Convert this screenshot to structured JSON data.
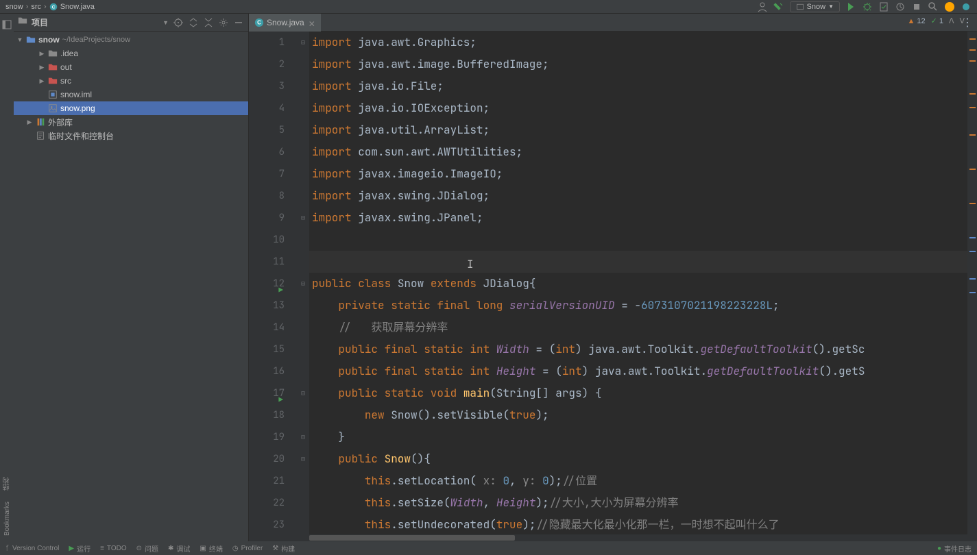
{
  "breadcrumb": [
    "snow",
    "src",
    "Snow.java"
  ],
  "runConfig": "Snow",
  "panel": {
    "title": "项目"
  },
  "tree": {
    "root": {
      "name": "snow",
      "path": "~/IdeaProjects/snow"
    },
    "items": [
      {
        "name": ".idea",
        "indent": 1,
        "expandable": true,
        "icon": "folder"
      },
      {
        "name": "out",
        "indent": 1,
        "expandable": true,
        "icon": "folder-red"
      },
      {
        "name": "src",
        "indent": 1,
        "expandable": true,
        "icon": "folder-red"
      },
      {
        "name": "snow.iml",
        "indent": 1,
        "expandable": false,
        "icon": "module"
      },
      {
        "name": "snow.png",
        "indent": 1,
        "expandable": false,
        "icon": "image",
        "selected": true
      },
      {
        "name": "外部库",
        "indent": 0,
        "expandable": true,
        "icon": "library"
      },
      {
        "name": "临时文件和控制台",
        "indent": 0,
        "expandable": false,
        "icon": "scratch"
      }
    ]
  },
  "tabs": [
    {
      "name": "Snow.java"
    }
  ],
  "inspection": {
    "warnings": 12,
    "pass": 1
  },
  "code": [
    {
      "n": 1,
      "tokens": [
        [
          "kw",
          "import"
        ],
        [
          "",
          " java.awt.Graphics;"
        ]
      ]
    },
    {
      "n": 2,
      "tokens": [
        [
          "kw",
          "import"
        ],
        [
          "",
          " java.awt.image.BufferedImage;"
        ]
      ]
    },
    {
      "n": 3,
      "tokens": [
        [
          "kw",
          "import"
        ],
        [
          "",
          " java.io.File;"
        ]
      ]
    },
    {
      "n": 4,
      "tokens": [
        [
          "kw",
          "import"
        ],
        [
          "",
          " java.io.IOException;"
        ]
      ]
    },
    {
      "n": 5,
      "tokens": [
        [
          "kw",
          "import"
        ],
        [
          "",
          " java.util.ArrayList;"
        ]
      ]
    },
    {
      "n": 6,
      "tokens": [
        [
          "kw",
          "import"
        ],
        [
          "",
          " com.sun.awt.AWTUtilities;"
        ]
      ]
    },
    {
      "n": 7,
      "tokens": [
        [
          "kw",
          "import"
        ],
        [
          "",
          " javax.imageio.ImageIO;"
        ]
      ]
    },
    {
      "n": 8,
      "tokens": [
        [
          "kw",
          "import"
        ],
        [
          "",
          " javax.swing.JDialog;"
        ]
      ]
    },
    {
      "n": 9,
      "tokens": [
        [
          "kw",
          "import"
        ],
        [
          "",
          " javax.swing.JPanel;"
        ]
      ]
    },
    {
      "n": 10,
      "tokens": []
    },
    {
      "n": 11,
      "tokens": [],
      "current": true
    },
    {
      "n": 12,
      "tokens": [
        [
          "kw",
          "public class "
        ],
        [
          "cls",
          "Snow "
        ],
        [
          "kw",
          "extends "
        ],
        [
          "cls",
          "JDialog"
        ],
        [
          "",
          "{"
        ]
      ],
      "run": true
    },
    {
      "n": 13,
      "tokens": [
        [
          "",
          "    "
        ],
        [
          "kw",
          "private static final long "
        ],
        [
          "fld",
          "serialVersionUID"
        ],
        [
          "",
          " = -"
        ],
        [
          "num",
          "6073107021198223228L"
        ],
        [
          "",
          ";"
        ]
      ]
    },
    {
      "n": 14,
      "tokens": [
        [
          "",
          "    "
        ],
        [
          "cmt",
          "//   获取屏幕分辨率"
        ]
      ]
    },
    {
      "n": 15,
      "tokens": [
        [
          "",
          "    "
        ],
        [
          "kw",
          "public final static int "
        ],
        [
          "fld",
          "Width"
        ],
        [
          "",
          " = ("
        ],
        [
          "kw",
          "int"
        ],
        [
          "",
          ") java.awt.Toolkit."
        ],
        [
          "fld",
          "getDefaultToolkit"
        ],
        [
          "",
          "().getSc"
        ]
      ]
    },
    {
      "n": 16,
      "tokens": [
        [
          "",
          "    "
        ],
        [
          "kw",
          "public final static int "
        ],
        [
          "fld",
          "Height"
        ],
        [
          "",
          " = ("
        ],
        [
          "kw",
          "int"
        ],
        [
          "",
          ") java.awt.Toolkit."
        ],
        [
          "fld",
          "getDefaultToolkit"
        ],
        [
          "",
          "().getS"
        ]
      ]
    },
    {
      "n": 17,
      "tokens": [
        [
          "",
          "    "
        ],
        [
          "kw",
          "public static void "
        ],
        [
          "mth",
          "main"
        ],
        [
          "",
          "(String[] args) {"
        ]
      ],
      "run": true
    },
    {
      "n": 18,
      "tokens": [
        [
          "",
          "        "
        ],
        [
          "kw",
          "new "
        ],
        [
          "",
          "Snow().setVisible("
        ],
        [
          "kw",
          "true"
        ],
        [
          "",
          ");"
        ]
      ]
    },
    {
      "n": 19,
      "tokens": [
        [
          "",
          "    }"
        ]
      ]
    },
    {
      "n": 20,
      "tokens": [
        [
          "",
          "    "
        ],
        [
          "kw",
          "public "
        ],
        [
          "mth",
          "Snow"
        ],
        [
          "",
          "(){"
        ]
      ]
    },
    {
      "n": 21,
      "tokens": [
        [
          "",
          "        "
        ],
        [
          "kw",
          "this"
        ],
        [
          "",
          ".setLocation( "
        ],
        [
          "param",
          "x: "
        ],
        [
          "num",
          "0"
        ],
        [
          "",
          ", "
        ],
        [
          "param",
          "y: "
        ],
        [
          "num",
          "0"
        ],
        [
          "",
          ");"
        ],
        [
          "cmt",
          "//位置"
        ]
      ]
    },
    {
      "n": 22,
      "tokens": [
        [
          "",
          "        "
        ],
        [
          "kw",
          "this"
        ],
        [
          "",
          ".setSize("
        ],
        [
          "fld",
          "Width"
        ],
        [
          "",
          ", "
        ],
        [
          "fld",
          "Height"
        ],
        [
          "",
          ");"
        ],
        [
          "cmt",
          "//大小,大小为屏幕分辨率"
        ]
      ]
    },
    {
      "n": 23,
      "tokens": [
        [
          "",
          "        "
        ],
        [
          "kw",
          "this"
        ],
        [
          "",
          ".setUndecorated("
        ],
        [
          "kw",
          "true"
        ],
        [
          "",
          ");"
        ],
        [
          "cmt",
          "//隐藏最大化最小化那一栏，一时想不起叫什么了"
        ]
      ]
    }
  ],
  "bottomBar": [
    "Version Control",
    "运行",
    "TODO",
    "问题",
    "调试",
    "终端",
    "Profiler",
    "构建"
  ],
  "statusRight": "事件日志"
}
